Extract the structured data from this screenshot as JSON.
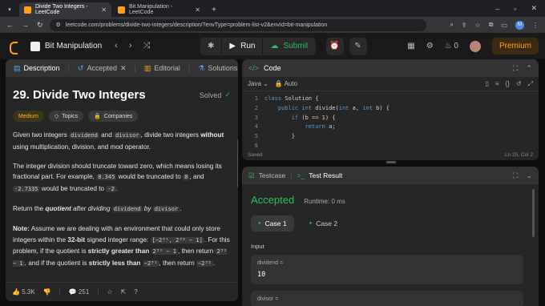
{
  "browser": {
    "tabs": [
      {
        "title": "Divide Two Integers - LeetCode"
      },
      {
        "title": "Bit Manipulation - LeetCode"
      }
    ],
    "url": "leetcode.com/problems/divide-two-integers/description/?envType=problem-list-v2&envId=bit-manipulation",
    "profile_initial": "M"
  },
  "header": {
    "list_name": "Bit Manipulation",
    "run_label": "Run",
    "submit_label": "Submit",
    "streak_count": "0",
    "premium_label": "Premium"
  },
  "left_panel": {
    "tabs": [
      "Description",
      "Accepted",
      "Editorial",
      "Solutions",
      "Su"
    ],
    "title": "29. Divide Two Integers",
    "solved_label": "Solved",
    "chips": [
      "Medium",
      "Topics",
      "Companies"
    ],
    "p1": {
      "a": "Given two integers ",
      "c1": "dividend",
      "b": " and ",
      "c2": "divisor",
      "c": ", divide two integers ",
      "strong": "without",
      "d": " using multiplication, division, and mod operator."
    },
    "p2": {
      "a": "The integer division should truncate toward zero, which means losing its fractional part. For example, ",
      "c1": "8.345",
      "b": " would be truncated to ",
      "c2": "8",
      "c": ", and ",
      "c3": "-2.7335",
      "d": " would be truncated to ",
      "c4": "-2",
      "e": "."
    },
    "p3": {
      "a": "Return the ",
      "em": "quotient",
      "b": " after dividing ",
      "c1": "dividend",
      "c": " by ",
      "c2": "divisor",
      "d": "."
    },
    "p4": {
      "note": "Note:",
      "a": " Assume we are dealing with an environment that could only store integers within the ",
      "strong1": "32-bit",
      "b": " signed integer range: ",
      "c1": "[−2³¹, 2³¹ − 1]",
      "c": ". For this problem, if the quotient is ",
      "strong2": "strictly greater than",
      "d": " ",
      "c2": "2³¹ − 1",
      "e": ", then return ",
      "c3": "2³¹ − 1",
      "f": ", and if the quotient is ",
      "strong3": "strictly less than",
      "g": " ",
      "c4": "−2³¹",
      "h": ", then return ",
      "c5": "−2³¹",
      "i": "."
    },
    "footer": {
      "likes": "5.3K",
      "comments": "251"
    }
  },
  "editor": {
    "title": "Code",
    "language": "Java",
    "mode": "Auto",
    "lines": [
      {
        "n": "1",
        "code": "class Solution {"
      },
      {
        "n": "2",
        "code": "    public int divide(int a, int b) {"
      },
      {
        "n": "3",
        "code": "        if (b == 1) {"
      },
      {
        "n": "4",
        "code": "            return a;"
      },
      {
        "n": "5",
        "code": "        }"
      },
      {
        "n": "6",
        "code": ""
      }
    ],
    "status_left": "Saved",
    "status_right": "Ln 25, Col 2"
  },
  "results": {
    "tabs": [
      "Testcase",
      "Test Result"
    ],
    "verdict": "Accepted",
    "runtime": "Runtime: 0 ms",
    "cases": [
      "Case 1",
      "Case 2"
    ],
    "input_label": "Input",
    "fields": [
      {
        "key": "dividend =",
        "value": "10"
      },
      {
        "key": "divisor =",
        "value": ""
      }
    ]
  }
}
